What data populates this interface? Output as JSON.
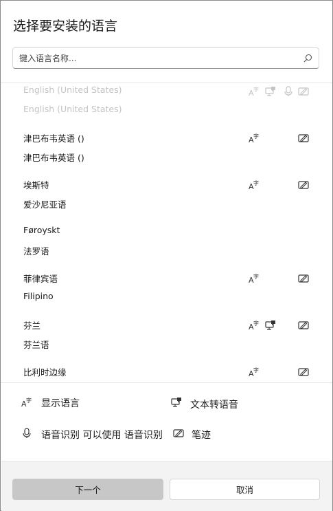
{
  "dialog": {
    "title": "选择要安装的语言",
    "search": {
      "placeholder": "键入语言名称..."
    }
  },
  "languages": [
    {
      "name": "English (United States)",
      "native": "English (United States)",
      "faded": true,
      "features": [
        "display",
        "tts",
        "speech",
        "handwriting"
      ]
    },
    {
      "name": "津巴布韦英语 ()",
      "native": "津巴布韦英语 ()",
      "faded": false,
      "features": [
        "display",
        "handwriting"
      ]
    },
    {
      "name": "埃斯特",
      "native": "爱沙尼亚语",
      "faded": false,
      "features": [
        "display",
        "handwriting"
      ]
    },
    {
      "name": "Føroyskt",
      "native": "法罗语",
      "faded": false,
      "features": []
    },
    {
      "name": "菲律宾语",
      "native": "Filipino",
      "faded": false,
      "features": [
        "display",
        "handwriting"
      ]
    },
    {
      "name": "芬兰",
      "native": "芬兰语",
      "faded": false,
      "features": [
        "display",
        "tts",
        "handwriting"
      ]
    },
    {
      "name": "比利时边缘",
      "native": "",
      "faded": false,
      "features": [
        "display",
        "handwriting"
      ]
    }
  ],
  "legend": {
    "display": "显示语言",
    "tts": "文本转语音",
    "speech": "语音识别 可以使用 语音识别",
    "handwriting": "笔迹"
  },
  "icons": {
    "display": "display-language-icon",
    "tts": "text-to-speech-icon",
    "speech": "microphone-icon",
    "handwriting": "handwriting-icon",
    "search": "search-icon"
  },
  "buttons": {
    "next": "下一个",
    "cancel": "取消"
  }
}
